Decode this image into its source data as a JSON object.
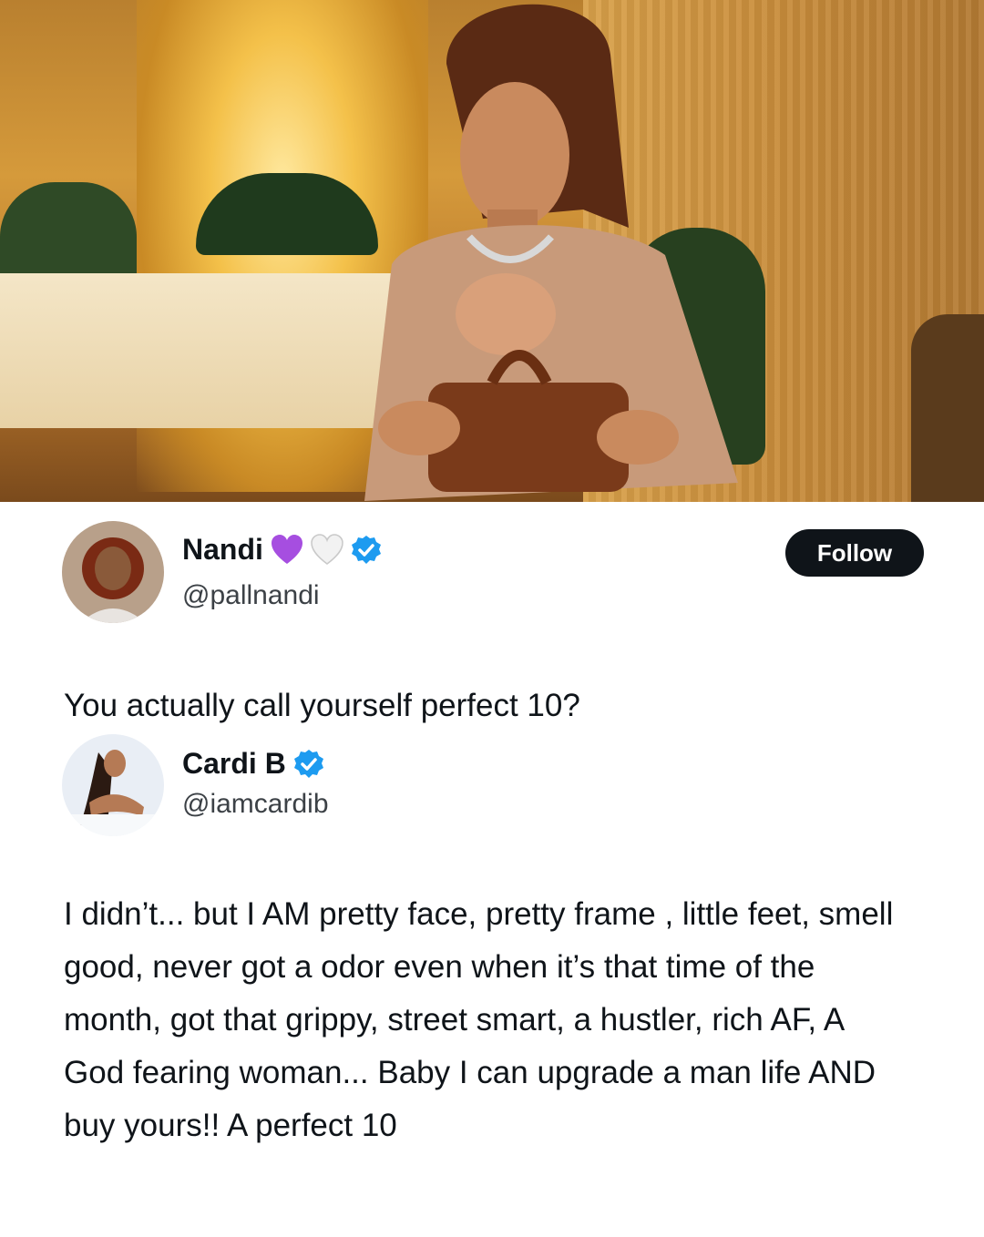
{
  "tweet_1": {
    "display_name": "Nandi",
    "handle": "@pallnandi",
    "name_emoji": [
      "purple-heart-icon",
      "white-heart-icon"
    ],
    "verified": true,
    "follow_label": "Follow",
    "text": "You actually call yourself perfect 10?"
  },
  "tweet_2": {
    "display_name": "Cardi B",
    "handle": "@iamcardib",
    "verified": true,
    "text": "I didn’t...  but I AM pretty face, pretty frame , little feet, smell good, never got a odor even when it’s that time of the month, got that grippy, street smart, a hustler, rich AF, A God fearing woman... Baby I can upgrade a man life AND buy yours!! A perfect 10"
  },
  "colors": {
    "verified_blue": "#1d9bf0",
    "follow_bg": "#0f1419",
    "purple_heart": "#a64ee0"
  }
}
